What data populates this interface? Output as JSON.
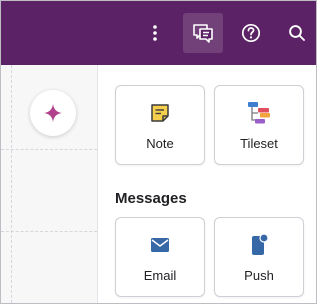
{
  "topbar": {
    "background": "#5b2265",
    "icons": [
      "more-vertical-icon",
      "comment-lines-icon",
      "help-circle-icon",
      "search-icon"
    ]
  },
  "canvas": {
    "fab_icon": "sparkle-icon",
    "fab_color": "#b0418c"
  },
  "panel": {
    "tiles_top": [
      {
        "label": "Note",
        "icon": "note-icon"
      },
      {
        "label": "Tileset",
        "icon": "tileset-icon"
      }
    ],
    "messages_title": "Messages",
    "tiles_messages": [
      {
        "label": "Email",
        "icon": "envelope-icon"
      },
      {
        "label": "Push",
        "icon": "push-notification-icon"
      }
    ]
  }
}
